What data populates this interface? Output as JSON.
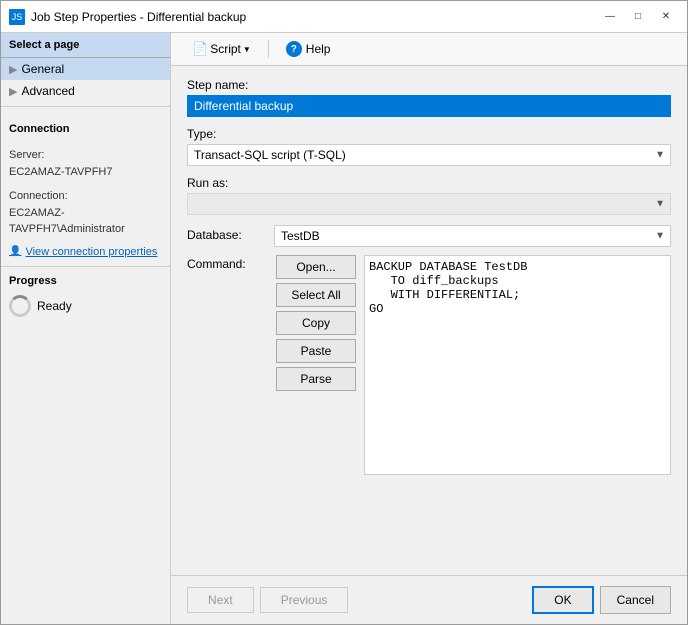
{
  "window": {
    "title": "Job Step Properties - Differential backup",
    "icon": "JS"
  },
  "title_controls": {
    "minimize": "—",
    "restore": "□",
    "close": "✕"
  },
  "toolbar": {
    "script_label": "Script",
    "help_label": "Help"
  },
  "sidebar": {
    "header": "Select a page",
    "items": [
      {
        "label": "General",
        "active": true
      },
      {
        "label": "Advanced",
        "active": false
      }
    ],
    "connection_header": "Connection",
    "server_label": "Server:",
    "server_value": "EC2AMAZ-TAVPFH7",
    "connection_label": "Connection:",
    "connection_value": "EC2AMAZ-TAVPFH7\\Administrator",
    "view_link": "View connection properties",
    "progress_header": "Progress",
    "progress_status": "Ready"
  },
  "form": {
    "step_name_label": "Step name:",
    "step_name_value": "Differential backup",
    "type_label": "Type:",
    "type_value": "Transact-SQL script (T-SQL)",
    "run_as_label": "Run as:",
    "run_as_value": "",
    "database_label": "Database:",
    "database_value": "TestDB",
    "command_label": "Command:",
    "command_value": "BACKUP DATABASE TestDB\r\n   TO diff_backups\r\n   WITH DIFFERENTIAL;\r\nGO"
  },
  "command_buttons": {
    "open": "Open...",
    "select_all": "Select All",
    "copy": "Copy",
    "paste": "Paste",
    "parse": "Parse"
  },
  "footer": {
    "next_label": "Next",
    "previous_label": "Previous",
    "ok_label": "OK",
    "cancel_label": "Cancel"
  }
}
